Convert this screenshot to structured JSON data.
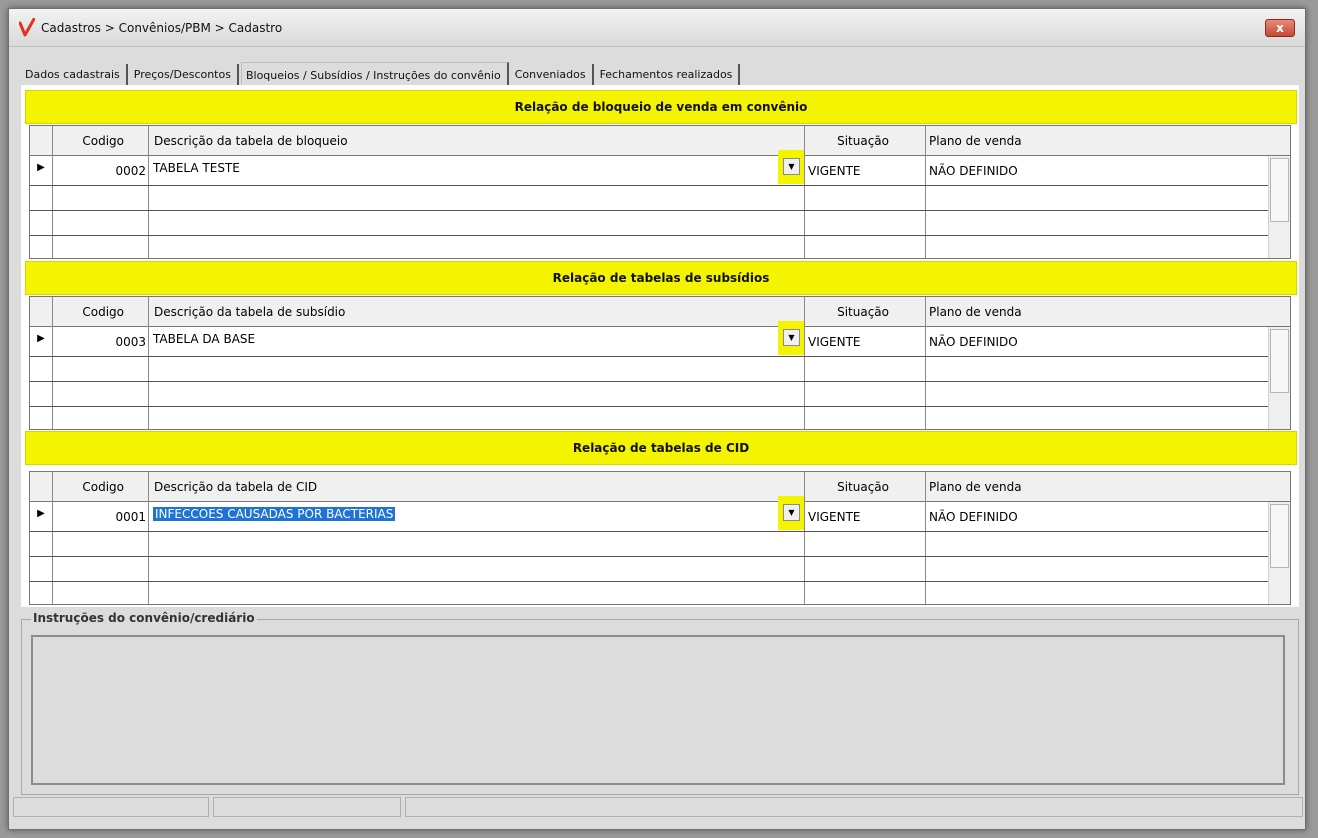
{
  "window": {
    "title": "Cadastros > Convênios/PBM > Cadastro",
    "close_label": "x"
  },
  "tabs": [
    {
      "label": "Dados cadastrais",
      "active": false
    },
    {
      "label": "Preços/Descontos",
      "active": false
    },
    {
      "label": "Bloqueios / Subsídios / Instruções do convênio",
      "active": true
    },
    {
      "label": "Conveniados",
      "active": false
    },
    {
      "label": "Fechamentos realizados",
      "active": false
    }
  ],
  "sections": {
    "bloqueio": {
      "title": "Relação de bloqueio de venda em convênio",
      "headers": {
        "codigo": "Codigo",
        "descricao": "Descrição da tabela de bloqueio",
        "situacao": "Situação",
        "plano": "Plano de venda"
      },
      "row": {
        "codigo": "0002",
        "descricao": "TABELA TESTE",
        "situacao": "VIGENTE",
        "plano": "NÃO DEFINIDO"
      }
    },
    "subsidio": {
      "title": "Relação de tabelas de subsídios",
      "headers": {
        "codigo": "Codigo",
        "descricao": "Descrição da tabela de subsídio",
        "situacao": "Situação",
        "plano": "Plano de venda"
      },
      "row": {
        "codigo": "0003",
        "descricao": "TABELA DA BASE",
        "situacao": "VIGENTE",
        "plano": "NÃO DEFINIDO"
      }
    },
    "cid": {
      "title": "Relação de tabelas de CID",
      "headers": {
        "codigo": "Codigo",
        "descricao": "Descrição da tabela de CID",
        "situacao": "Situação",
        "plano": "Plano de venda"
      },
      "row": {
        "codigo": "0001",
        "descricao": "INFECCOES CAUSADAS POR BACTERIAS",
        "situacao": "VIGENTE",
        "plano": "NÃO DEFINIDO"
      }
    }
  },
  "instructions": {
    "legend": "Instruções do convênio/crediário",
    "value": ""
  },
  "colors": {
    "highlight": "#f4f400",
    "selection": "#1f74d3"
  }
}
